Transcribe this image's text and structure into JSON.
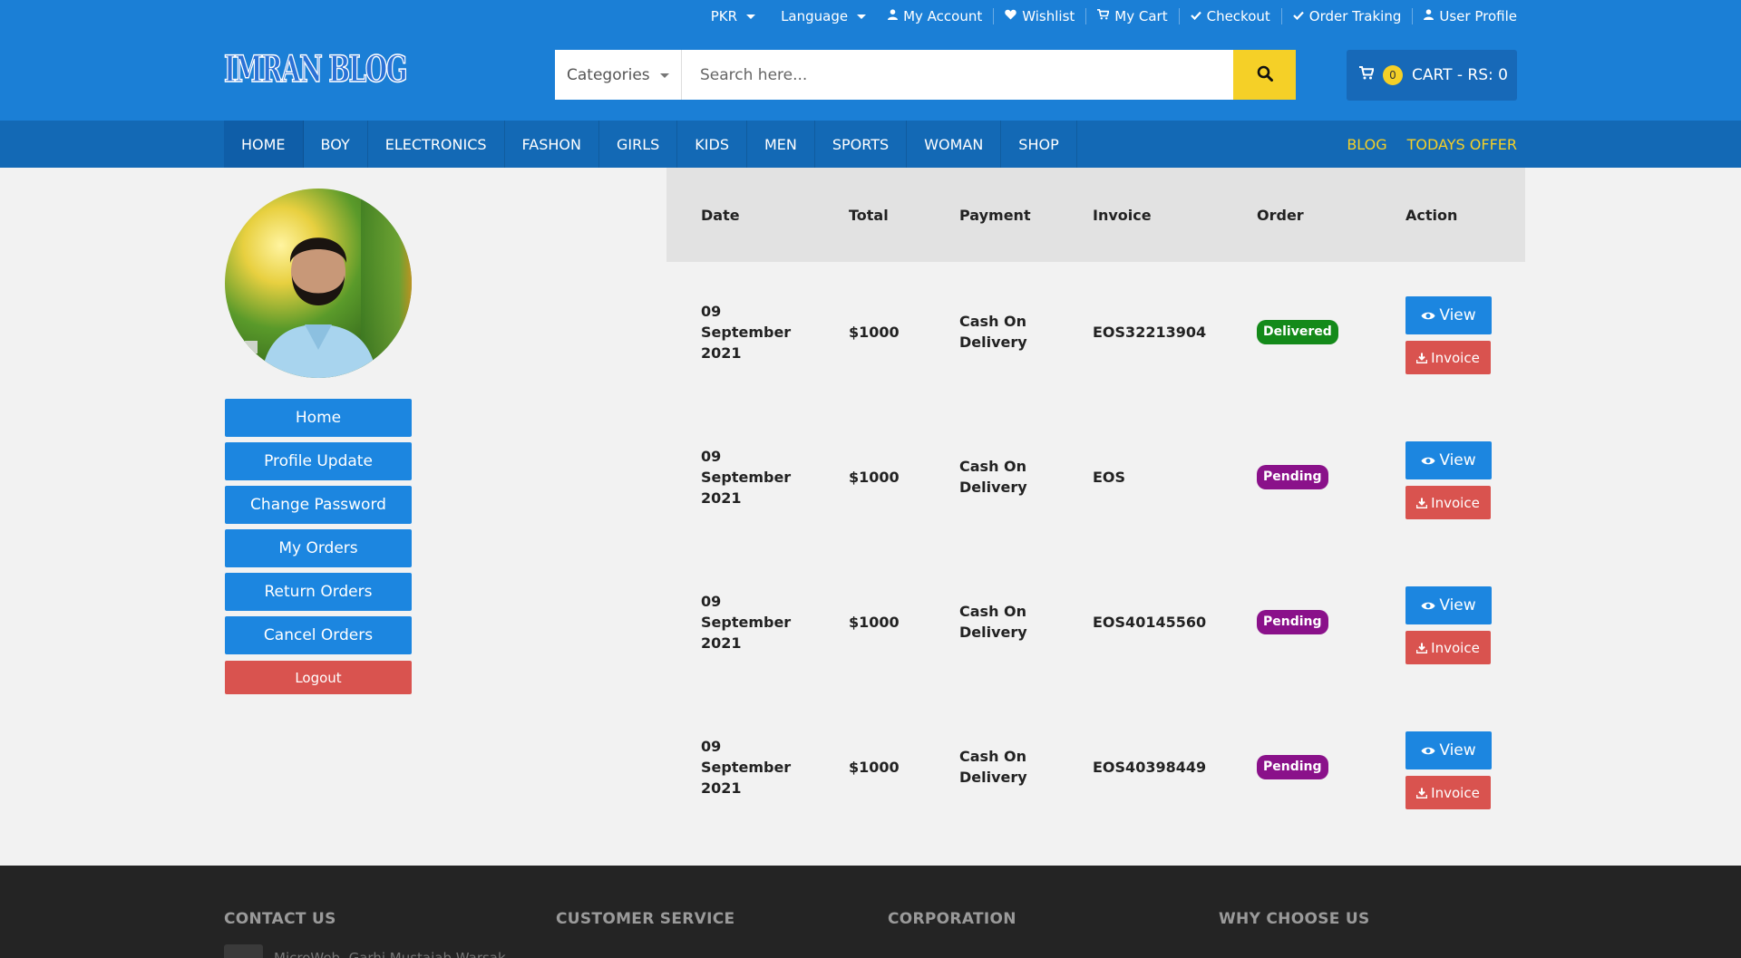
{
  "topbar": {
    "currency": "PKR",
    "language": "Language",
    "links": [
      {
        "label": "My Account",
        "icon": "user-icon"
      },
      {
        "label": "Wishlist",
        "icon": "heart-icon"
      },
      {
        "label": "My Cart",
        "icon": "cart-icon"
      },
      {
        "label": "Checkout",
        "icon": "check-icon"
      },
      {
        "label": "Order Traking",
        "icon": "check-icon"
      },
      {
        "label": "User Profile",
        "icon": "user-icon"
      }
    ]
  },
  "logo": {
    "text": "IMRAN BLOG"
  },
  "search": {
    "category": "Categories",
    "placeholder": "Search here..."
  },
  "cart": {
    "count": "0",
    "label": "CART - RS: 0"
  },
  "nav": {
    "items": [
      "HOME",
      "BOY",
      "ELECTRONICS",
      "FASHON",
      "GIRLS",
      "KIDS",
      "MEN",
      "SPORTS",
      "WOMAN",
      "SHOP"
    ],
    "right": [
      "BLOG",
      "TODAYS OFFER"
    ]
  },
  "sidebar": {
    "buttons": [
      "Home",
      "Profile Update",
      "Change Password",
      "My Orders",
      "Return Orders",
      "Cancel Orders"
    ],
    "logout": "Logout"
  },
  "table": {
    "headers": [
      "Date",
      "Total",
      "Payment",
      "Invoice",
      "Order",
      "Action"
    ],
    "rows": [
      {
        "date_l1": "09",
        "date_l2": "September",
        "date_l3": "2021",
        "total": "$1000",
        "pay_l1": "Cash On",
        "pay_l2": "Delivery",
        "invoice": "EOS32213904",
        "status": "Delivered"
      },
      {
        "date_l1": "09",
        "date_l2": "September",
        "date_l3": "2021",
        "total": "$1000",
        "pay_l1": "Cash On",
        "pay_l2": "Delivery",
        "invoice": "EOS",
        "status": "Pending"
      },
      {
        "date_l1": "09",
        "date_l2": "September",
        "date_l3": "2021",
        "total": "$1000",
        "pay_l1": "Cash On",
        "pay_l2": "Delivery",
        "invoice": "EOS40145560",
        "status": "Pending"
      },
      {
        "date_l1": "09",
        "date_l2": "September",
        "date_l3": "2021",
        "total": "$1000",
        "pay_l1": "Cash On",
        "pay_l2": "Delivery",
        "invoice": "EOS40398449",
        "status": "Pending"
      }
    ],
    "view_label": "View",
    "invoice_label": "Invoice"
  },
  "footer": {
    "headings": [
      "CONTACT US",
      "CUSTOMER SERVICE",
      "CORPORATION",
      "WHY CHOOSE US"
    ],
    "address": "MicroWeb, Garhi Mustajab Warsak"
  },
  "colors": {
    "header": "#1b7fd6",
    "nav": "#1369b5",
    "accent_yellow": "#f5d027",
    "primary_button": "#1c86e0",
    "danger_button": "#d9534f",
    "delivered": "#148a1a",
    "pending": "#8a118a",
    "footer": "#242424"
  }
}
